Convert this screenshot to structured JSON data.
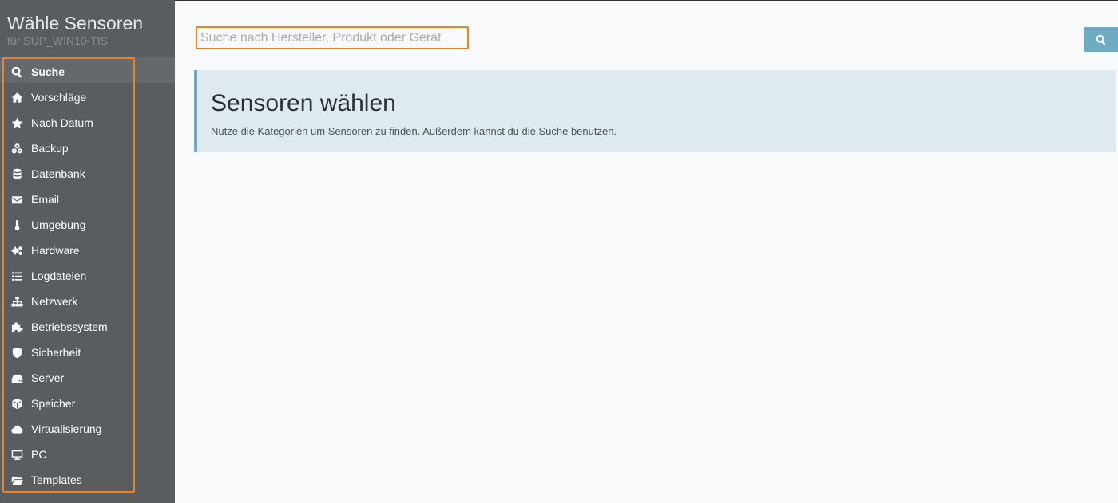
{
  "sidebar": {
    "title": "Wähle Sensoren",
    "subtitle": "für SUP_WIN10-TIS",
    "items": [
      {
        "label": "Suche",
        "icon": "search-icon"
      },
      {
        "label": "Vorschläge",
        "icon": "home-icon"
      },
      {
        "label": "Nach Datum",
        "icon": "star-icon"
      },
      {
        "label": "Backup",
        "icon": "backup-icon"
      },
      {
        "label": "Datenbank",
        "icon": "database-icon"
      },
      {
        "label": "Email",
        "icon": "envelope-icon"
      },
      {
        "label": "Umgebung",
        "icon": "thermometer-icon"
      },
      {
        "label": "Hardware",
        "icon": "cogs-icon"
      },
      {
        "label": "Logdateien",
        "icon": "list-icon"
      },
      {
        "label": "Netzwerk",
        "icon": "sitemap-icon"
      },
      {
        "label": "Betriebssystem",
        "icon": "puzzle-icon"
      },
      {
        "label": "Sicherheit",
        "icon": "shield-icon"
      },
      {
        "label": "Server",
        "icon": "server-icon"
      },
      {
        "label": "Speicher",
        "icon": "cube-icon"
      },
      {
        "label": "Virtualisierung",
        "icon": "cloud-icon"
      },
      {
        "label": "PC",
        "icon": "desktop-icon"
      },
      {
        "label": "Templates",
        "icon": "folder-open-icon"
      }
    ]
  },
  "search": {
    "placeholder": "Suche nach Hersteller, Produkt oder Gerät",
    "value": ""
  },
  "info": {
    "title": "Sensoren wählen",
    "text": "Nutze die Kategorien um Sensoren zu finden. Außerdem kannst du die Suche benutzen."
  },
  "colors": {
    "sidebar_bg": "#5a5d60",
    "accent": "#6dacc3",
    "highlight_border": "#f0821e",
    "info_bg": "#deeaef"
  }
}
